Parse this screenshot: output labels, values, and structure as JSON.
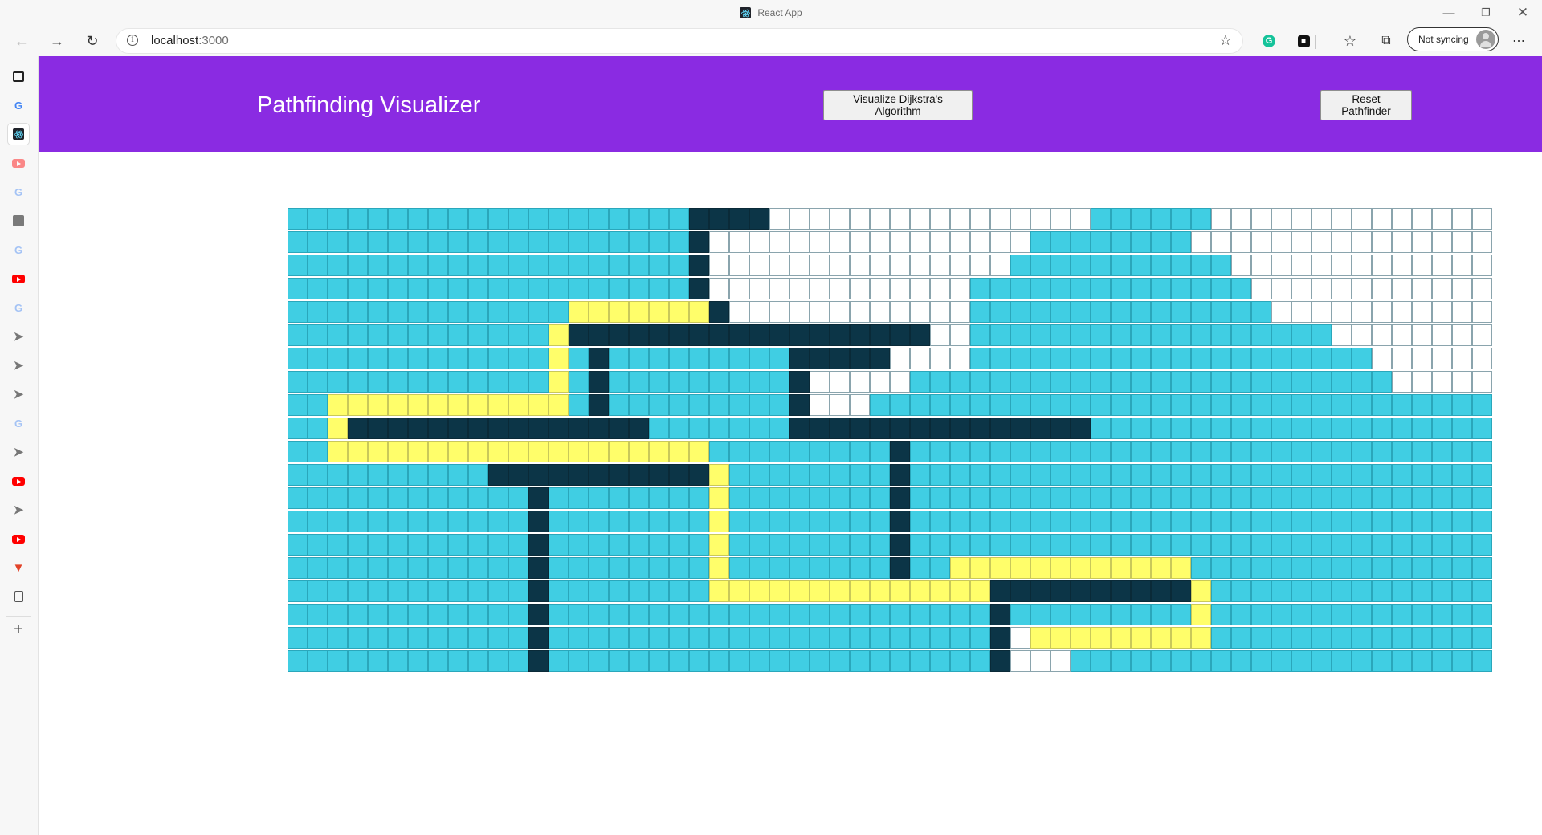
{
  "browser": {
    "tab_title": "React App",
    "url_host": "localhost",
    "url_path": ":3000",
    "sync_label": "Not syncing",
    "icons": [
      "back-arrow-icon",
      "forward-arrow-icon",
      "refresh-icon",
      "info-icon",
      "favorite-add-icon",
      "grammarly-icon",
      "extension-icon",
      "favorites-icon",
      "collections-icon",
      "profile-avatar-icon",
      "more-menu-icon"
    ]
  },
  "sidebar": {
    "icons": [
      "news-icon",
      "google-icon",
      "react-icon",
      "youtube-icon",
      "google-icon",
      "vscode-icon",
      "google-icon",
      "youtube-icon",
      "google-icon",
      "send-icon",
      "send-icon",
      "send-icon",
      "google-icon",
      "send-icon",
      "youtube-icon",
      "send-icon",
      "youtube-icon",
      "gitlab-icon",
      "document-icon",
      "add-icon"
    ]
  },
  "header": {
    "title": "Pathfinding Visualizer",
    "visualize_label": "Visualize Dijkstra's Algorithm",
    "reset_label": "Reset Pathfinder"
  },
  "colors": {
    "header_bg": "#8a2be2",
    "visited": "#40cee3",
    "wall": "#0c3547",
    "path": "#fffe6a",
    "unvisited": "#ffffff"
  },
  "grid": {
    "legend": {
      "v": "visited",
      "w": "wall",
      "p": "shortest-path",
      "e": "unvisited"
    },
    "rows": [
      "vvvvvvvvvvvvvvvvvvvvwwwweeeeeeeeeeeeeeeevvvvvveeeeeeeeeeeeee",
      "vvvvvvvvvvvvvvvvvvvvweeeeeeeeeeeeeeeevvvvvvvveeeeeeeeeeeeeee",
      "vvvvvvvvvvvvvvvvvvvvweeeeeeeeeeeeeeevvvvvvvvvvveeeeeeeeeeeee",
      "vvvvvvvvvvvvvvvvvvvvweeeeeeeeeeeeevvvvvvvvvvvvvveeeeeeeeeeee",
      "vvvvvvvvvvvvvvpppppppweeeeeeeeeeeevvvvvvvvvvvvvvveeeeeeeeeee",
      "vvvvvvvvvvvvvpwwwwwwwwwwwwwwwwwweevvvvvvvvvvvvvvvvvveeeeeeee",
      "vvvvvvvvvvvvvpvwvvvvvvvvvwwwwweeeevvvvvvvvvvvvvvvvvvvveeeeee",
      "vvvvvvvvvvvvvpvwvvvvvvvvvweeeeevvvvvvvvvvvvvvvvvvvvvvvveeeee",
      "vvppppppppppppvwvvvvvvvvvweeevvvvvvvvvvvvvvvvvvvvvvvvvvvvvvv",
      "vvpwwwwwwwwwwwwwwwvvvvvvvwwwwwwwwwwwwwwwvvvvvvvvvvvvvvvvvvvv",
      "vvpppppppppppppppppppvvvvvvvvvwvvvvvvvvvvvvvvvvvvvvvvvvvvvvv",
      "vvvvvvvvvvwwwwwwwwwwwpvvvvvvvvwvvvvvvvvvvvvvvvvvvvvvvvvvvvvv",
      "vvvvvvvvvvvvwvvvvvvvvpvvvvvvvvwvvvvvvvvvvvvvvvvvvvvvvvvvvvvv",
      "vvvvvvvvvvvvwvvvvvvvvpvvvvvvvvwvvvvvvvvvvvvvvvvvvvvvvvvvvvvv",
      "vvvvvvvvvvvvwvvvvvvvvpvvvvvvvvwvvvvvvvvvvvvvvvvvvvvvvvvvvvvv",
      "vvvvvvvvvvvvwvvvvvvvvpvvvvvvvvwvvppppppppppppvvvvvvvvvvvvvvv",
      "vvvvvvvvvvvvwvvvvvvvvppppppppppppppwwwwwwwwwwpvvvvvvvvvvvvvv",
      "vvvvvvvvvvvvwvvvvvvvvvvvvvvvvvvvvvvwvvvvvvvvvpvvvvvvvvvvvvvv",
      "vvvvvvvvvvvvwvvvvvvvvvvvvvvvvvvvvvvwepppppppppvvvvvvvvvvvvvv",
      "vvvvvvvvvvvvwvvvvvvvvvvvvvvvvvvvvvvweeevvvvvvvvvvvvvvvvvvvvv"
    ]
  }
}
